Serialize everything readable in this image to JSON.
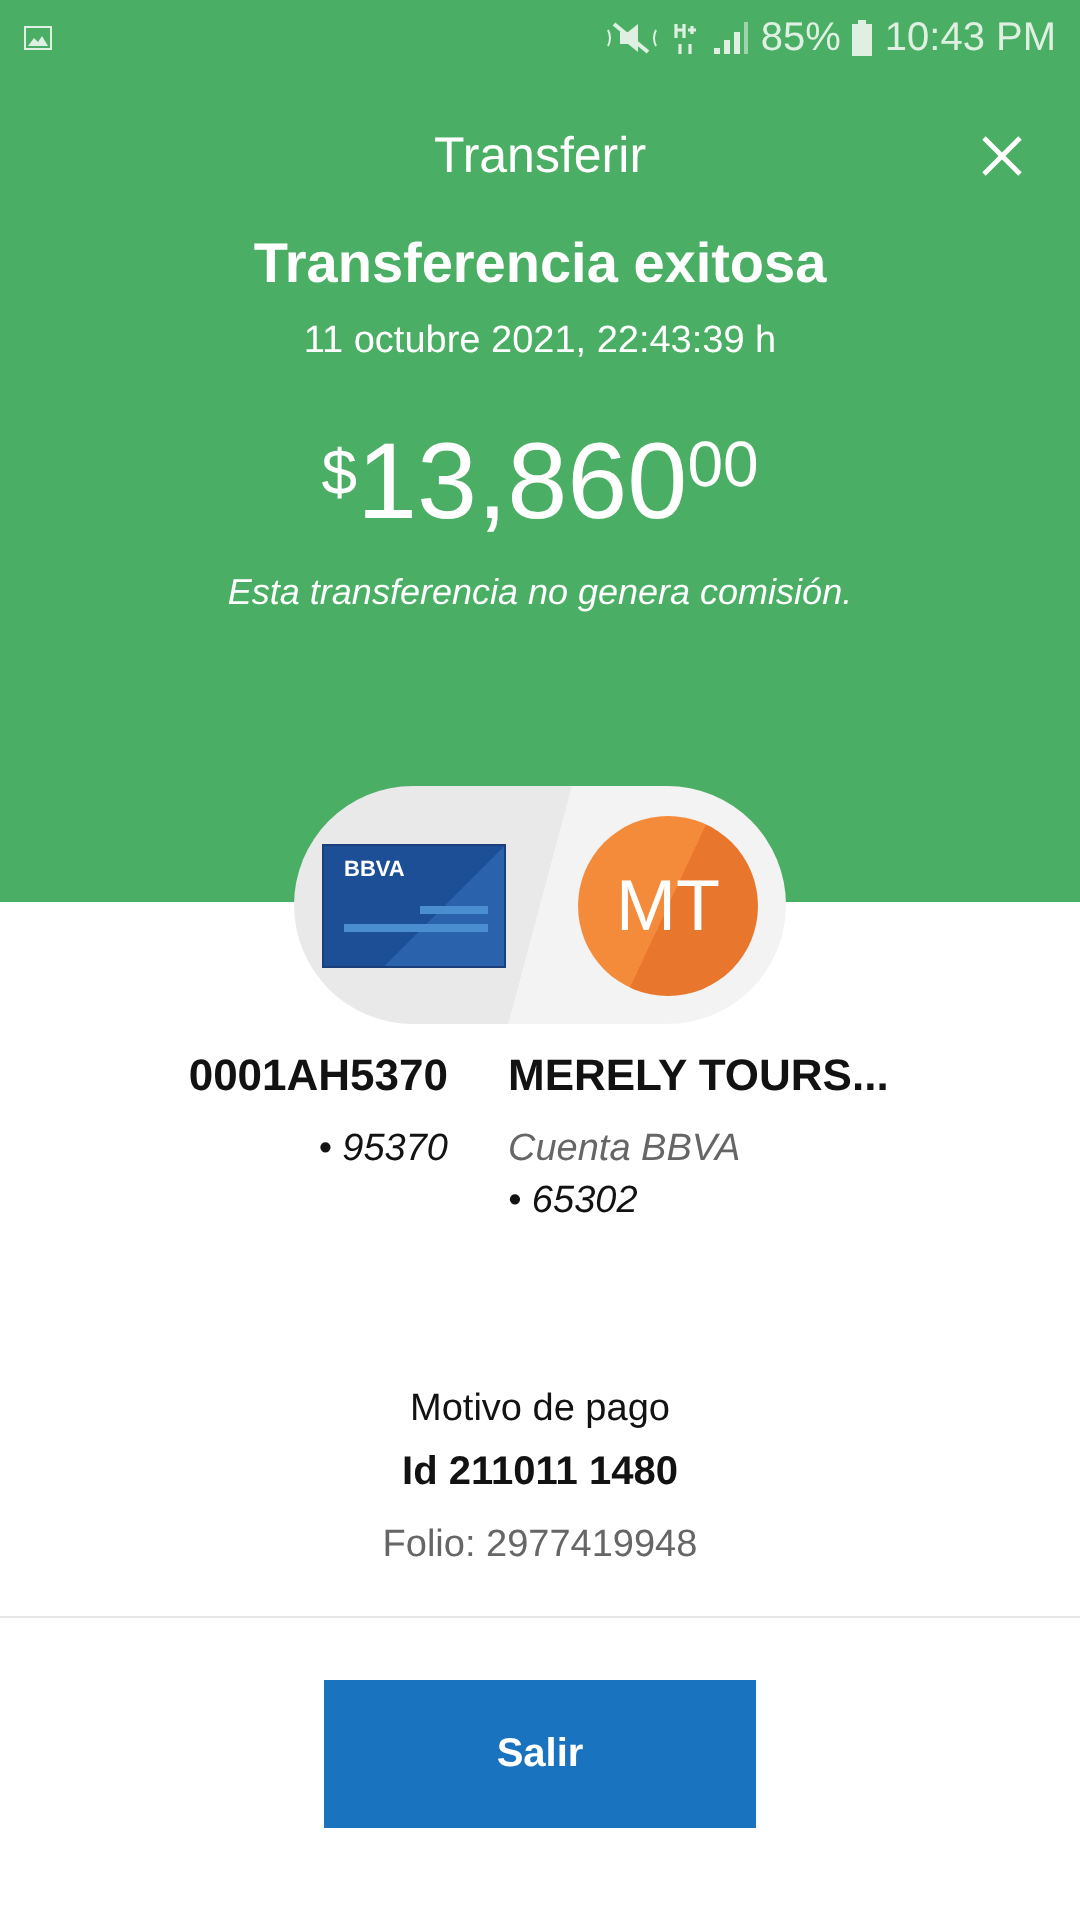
{
  "status_bar": {
    "battery": "85%",
    "time": "10:43 PM"
  },
  "header": {
    "title": "Transferir"
  },
  "result": {
    "heading": "Transferencia exitosa",
    "date": "11 octubre 2021, 22:43:39 h",
    "currency": "$",
    "amount": "13,860",
    "cents": "00",
    "note": "Esta transferencia no genera comisión."
  },
  "origin": {
    "card_brand": "BBVA",
    "name": "0001AH5370",
    "number": "• 95370"
  },
  "destination": {
    "initials": "MT",
    "name": "MERELY TOURS...",
    "account_type": "Cuenta BBVA",
    "number": "• 65302"
  },
  "details": {
    "concept_label": "Motivo de pago",
    "concept": "Id 211011 1480",
    "folio": "Folio: 2977419948"
  },
  "buttons": [
    {
      "label": "Salir"
    }
  ]
}
